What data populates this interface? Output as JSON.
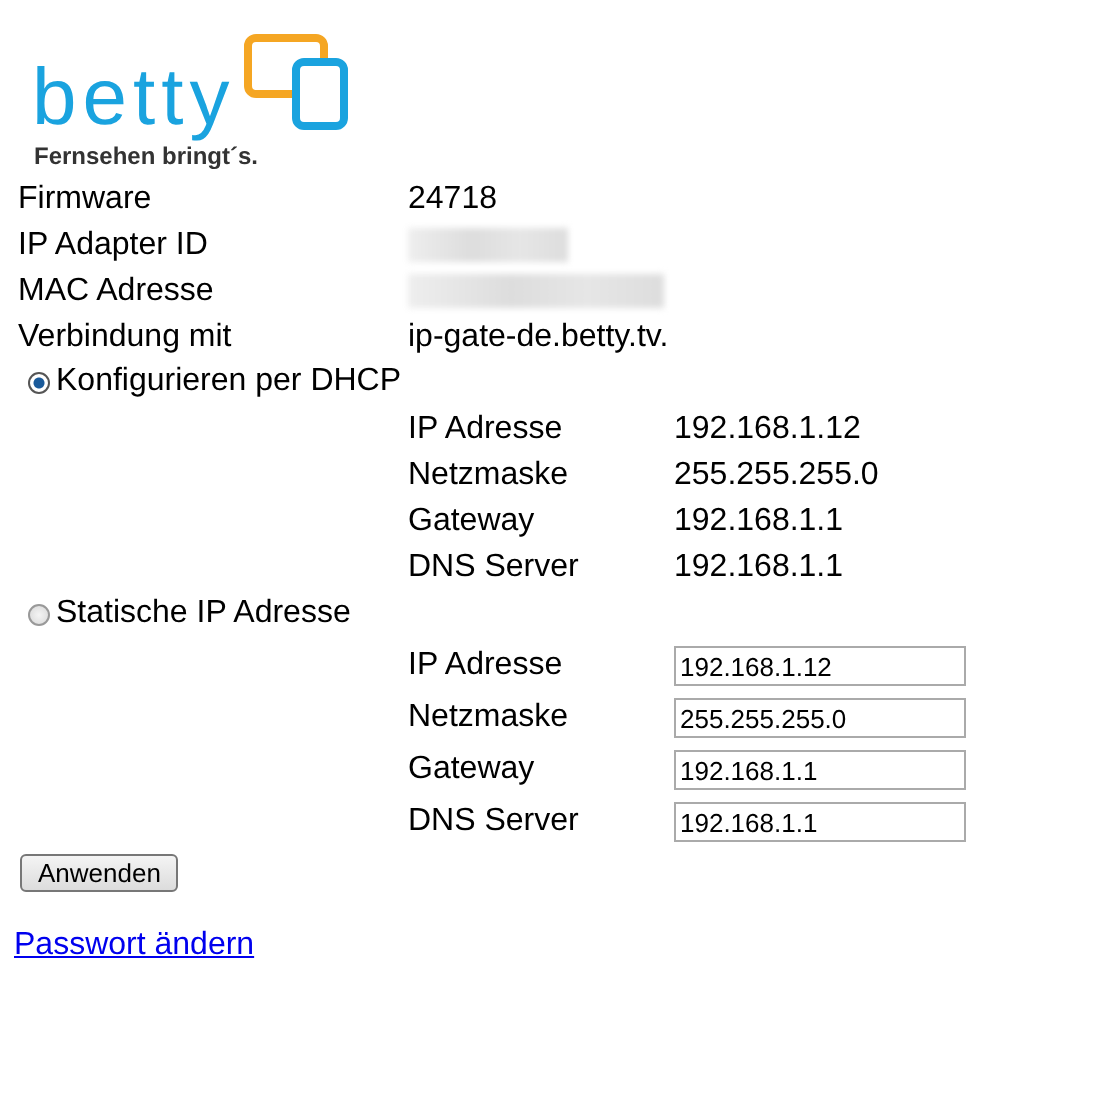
{
  "logo": {
    "wordmark": "betty",
    "tagline": "Fernsehen bringt´s."
  },
  "info": [
    {
      "label": "Firmware",
      "value": "24718",
      "redacted": false
    },
    {
      "label": "IP Adapter ID",
      "redacted": true
    },
    {
      "label": "MAC Adresse",
      "redacted": true
    },
    {
      "label": "Verbindung mit",
      "value": "ip-gate-de.betty.tv.",
      "redacted": false
    }
  ],
  "modes": [
    {
      "label": "Konfigurieren per DHCP",
      "selected": true,
      "kind": "readonly",
      "fields": [
        {
          "label": "IP Adresse",
          "value": "192.168.1.12"
        },
        {
          "label": "Netzmaske",
          "value": "255.255.255.0"
        },
        {
          "label": "Gateway",
          "value": "192.168.1.1"
        },
        {
          "label": "DNS Server",
          "value": "192.168.1.1"
        }
      ]
    },
    {
      "label": "Statische IP Adresse",
      "selected": false,
      "kind": "input",
      "fields": [
        {
          "label": "IP Adresse",
          "value": "192.168.1.12"
        },
        {
          "label": "Netzmaske",
          "value": "255.255.255.0"
        },
        {
          "label": "Gateway",
          "value": "192.168.1.1"
        },
        {
          "label": "DNS Server",
          "value": "192.168.1.1"
        }
      ]
    }
  ],
  "apply_button": "Anwenden",
  "password_link": "Passwort ändern"
}
